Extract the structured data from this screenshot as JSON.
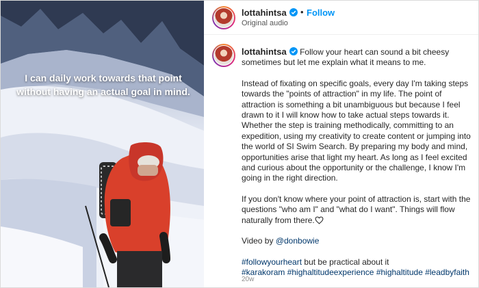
{
  "media": {
    "caption": "I can daily work towards that point without having an actual goal in mind."
  },
  "header": {
    "username": "lottahintsa",
    "dot": "•",
    "follow_label": "Follow",
    "audio_label": "Original audio"
  },
  "post": {
    "username": "lottahintsa",
    "intro": "Follow your heart can sound a bit cheesy sometimes but let me explain what it means to me.",
    "paragraph_1": "Instead of fixating on specific goals, every day I'm taking steps towards the \"points of attraction\" in my life. The point of attraction is something a bit unambiguous but because I feel drawn to it I will know how to take actual steps towards it. Whether the step is training methodically, committing to an expedition, using my creativity to create content or jumping into the world of SI Swim Search. By preparing my body and mind, opportunities arise that light my heart. As long as I feel excited and curious about the opportunity or the challenge, I know I'm going in the right direction.",
    "paragraph_2": "If you don't know where your point of attraction is, start with the questions \"who am I\" and \"what do I want\". Things will flow naturally from there.",
    "video_by": "Video by",
    "video_author": "@donbowie",
    "hashtag_1": "#followyourheart",
    "after_hashtag_1": "but be practical about it",
    "hashtags": [
      "#karakoram",
      "#highaltitudeexperience",
      "#highaltitude",
      "#leadbyfaith"
    ],
    "time": "20w"
  },
  "colors": {
    "link": "#00376b",
    "follow": "#0095f6",
    "verified": "#0095f6"
  }
}
